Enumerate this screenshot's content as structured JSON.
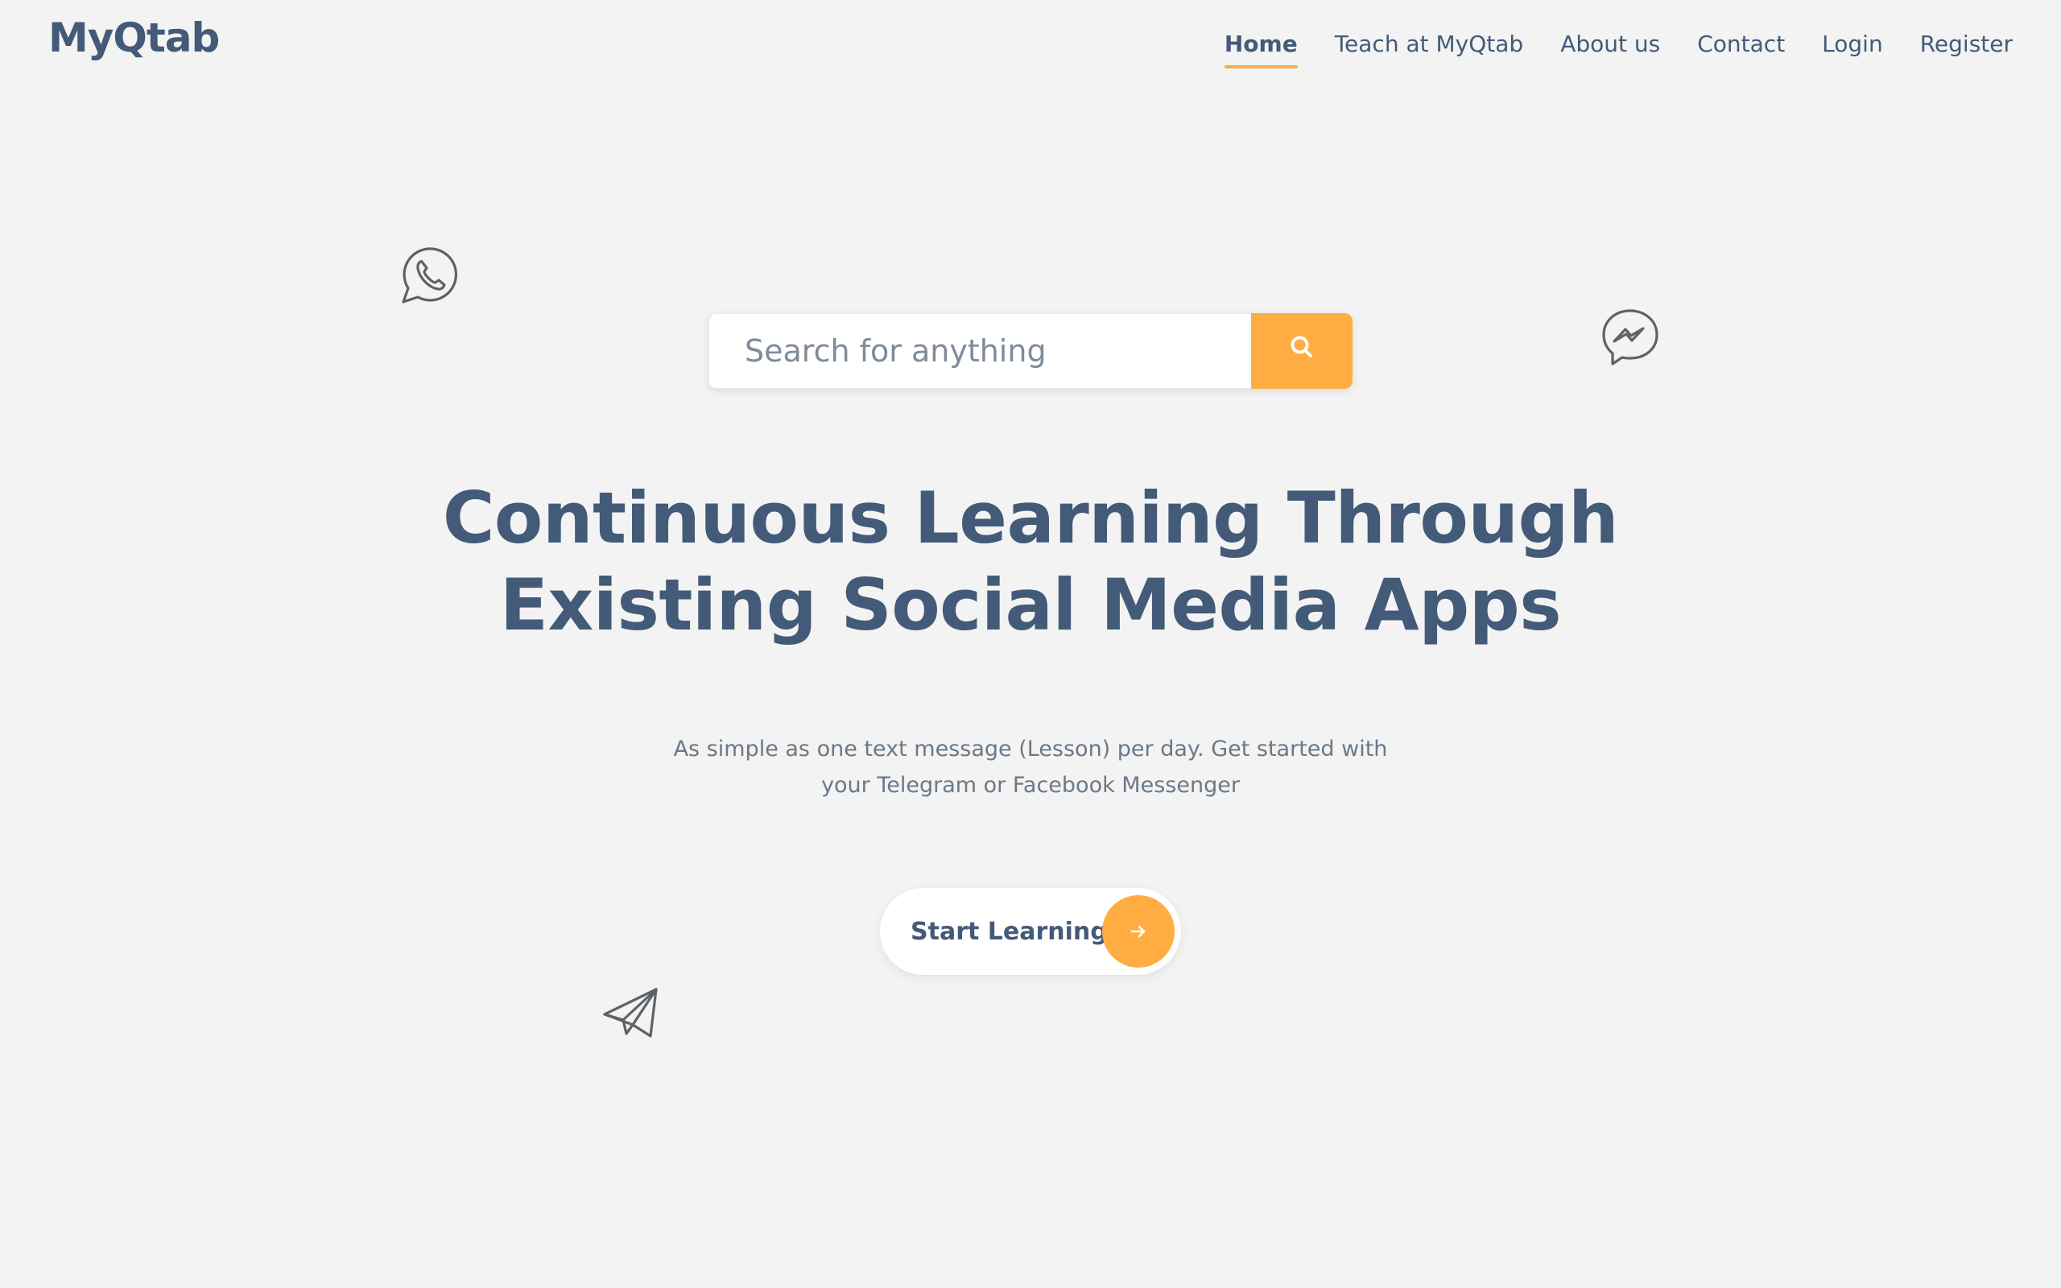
{
  "brand": {
    "name": "MyQtab"
  },
  "nav": {
    "items": [
      {
        "label": "Home",
        "active": true
      },
      {
        "label": "Teach at MyQtab",
        "active": false
      },
      {
        "label": "About us",
        "active": false
      },
      {
        "label": "Contact",
        "active": false
      },
      {
        "label": "Login",
        "active": false
      },
      {
        "label": "Register",
        "active": false
      }
    ]
  },
  "search": {
    "placeholder": "Search for anything",
    "value": "",
    "button_icon": "search-icon"
  },
  "hero": {
    "title_line1": "Continuous Learning Through",
    "title_line2": "Existing Social Media Apps",
    "subtitle_line1": "As simple as one text message (Lesson) per day. Get started with",
    "subtitle_line2": "your Telegram or Facebook Messenger"
  },
  "cta": {
    "label": "Start Learning",
    "icon": "arrow-right-icon"
  },
  "decor_icons": [
    "whatsapp-icon",
    "messenger-icon",
    "telegram-icon"
  ],
  "colors": {
    "accent": "#ffad42",
    "text_primary": "#435a78",
    "text_muted": "#6b7887",
    "background": "#f2f3f2"
  }
}
